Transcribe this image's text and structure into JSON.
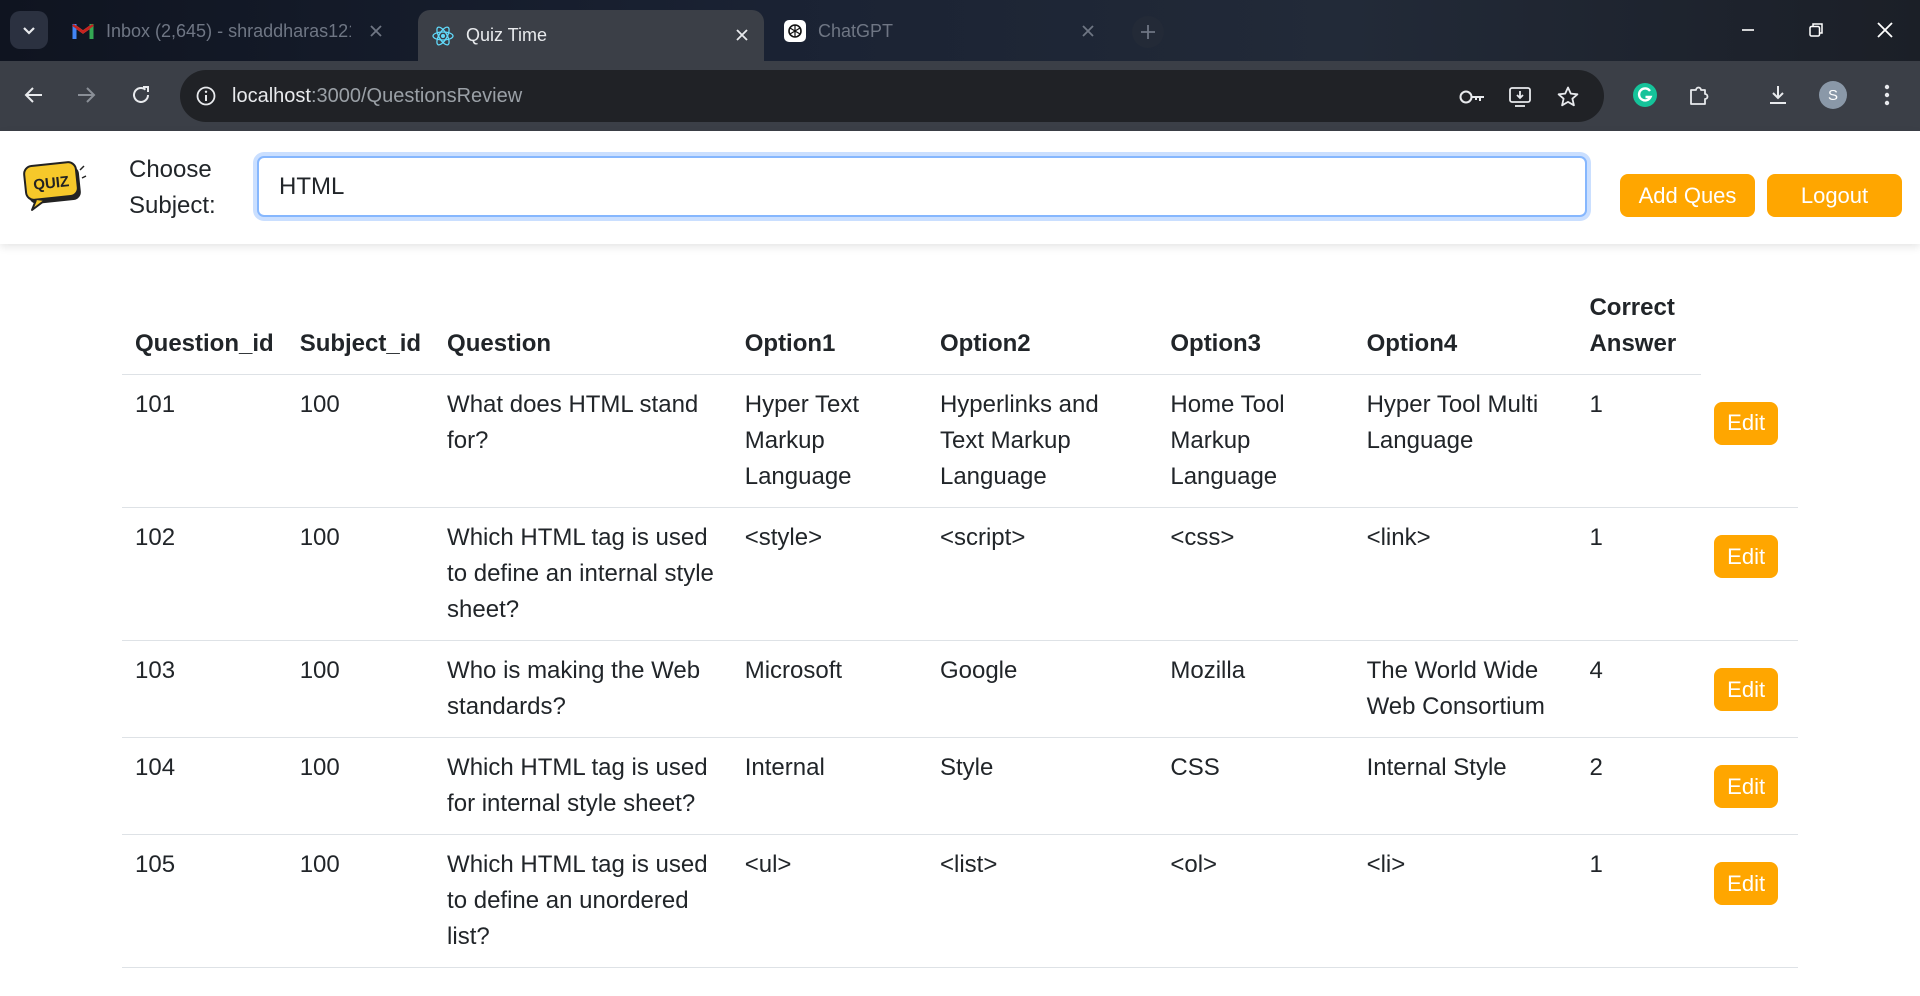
{
  "browser": {
    "tabs": [
      {
        "title": "Inbox (2,645) - shraddharas121",
        "icon": "gmail-icon"
      },
      {
        "title": "Quiz Time",
        "icon": "react-icon"
      },
      {
        "title": "ChatGPT",
        "icon": "chatgpt-icon"
      }
    ],
    "url_host": "localhost",
    "url_path": ":3000/QuestionsReview",
    "profile_initial": "S"
  },
  "header": {
    "logo_text": "QUIZ",
    "subject_label": "Choose Subject:",
    "subject_value": "HTML",
    "add_button": "Add Ques",
    "logout_button": "Logout"
  },
  "table": {
    "columns": [
      "Question_id",
      "Subject_id",
      "Question",
      "Option1",
      "Option2",
      "Option3",
      "Option4",
      "Correct Answer"
    ],
    "edit_label": "Edit",
    "rows": [
      {
        "question_id": "101",
        "subject_id": "100",
        "question": "What does HTML stand for?",
        "option1": "Hyper Text Markup Language",
        "option2": "Hyperlinks and Text Markup Language",
        "option3": "Home Tool Markup Language",
        "option4": "Hyper Tool Multi Language",
        "answer": "1"
      },
      {
        "question_id": "102",
        "subject_id": "100",
        "question": "Which HTML tag is used to define an internal style sheet?",
        "option1": "<style>",
        "option2": "<script>",
        "option3": "<css>",
        "option4": "<link>",
        "answer": "1"
      },
      {
        "question_id": "103",
        "subject_id": "100",
        "question": "Who is making the Web standards?",
        "option1": "Microsoft",
        "option2": "Google",
        "option3": "Mozilla",
        "option4": "The World Wide Web Consortium",
        "answer": "4"
      },
      {
        "question_id": "104",
        "subject_id": "100",
        "question": "Which HTML tag is used for internal style sheet?",
        "option1": "Internal",
        "option2": "Style",
        "option3": "CSS",
        "option4": "Internal Style",
        "answer": "2"
      },
      {
        "question_id": "105",
        "subject_id": "100",
        "question": "Which HTML tag is used to define an unordered list?",
        "option1": "<ul>",
        "option2": "<list>",
        "option3": "<ol>",
        "option4": "<li>",
        "answer": "1"
      }
    ]
  },
  "colors": {
    "accent": "#ffa600",
    "focus": "#86b7fe",
    "chrome_toolbar": "#3b3f47"
  }
}
